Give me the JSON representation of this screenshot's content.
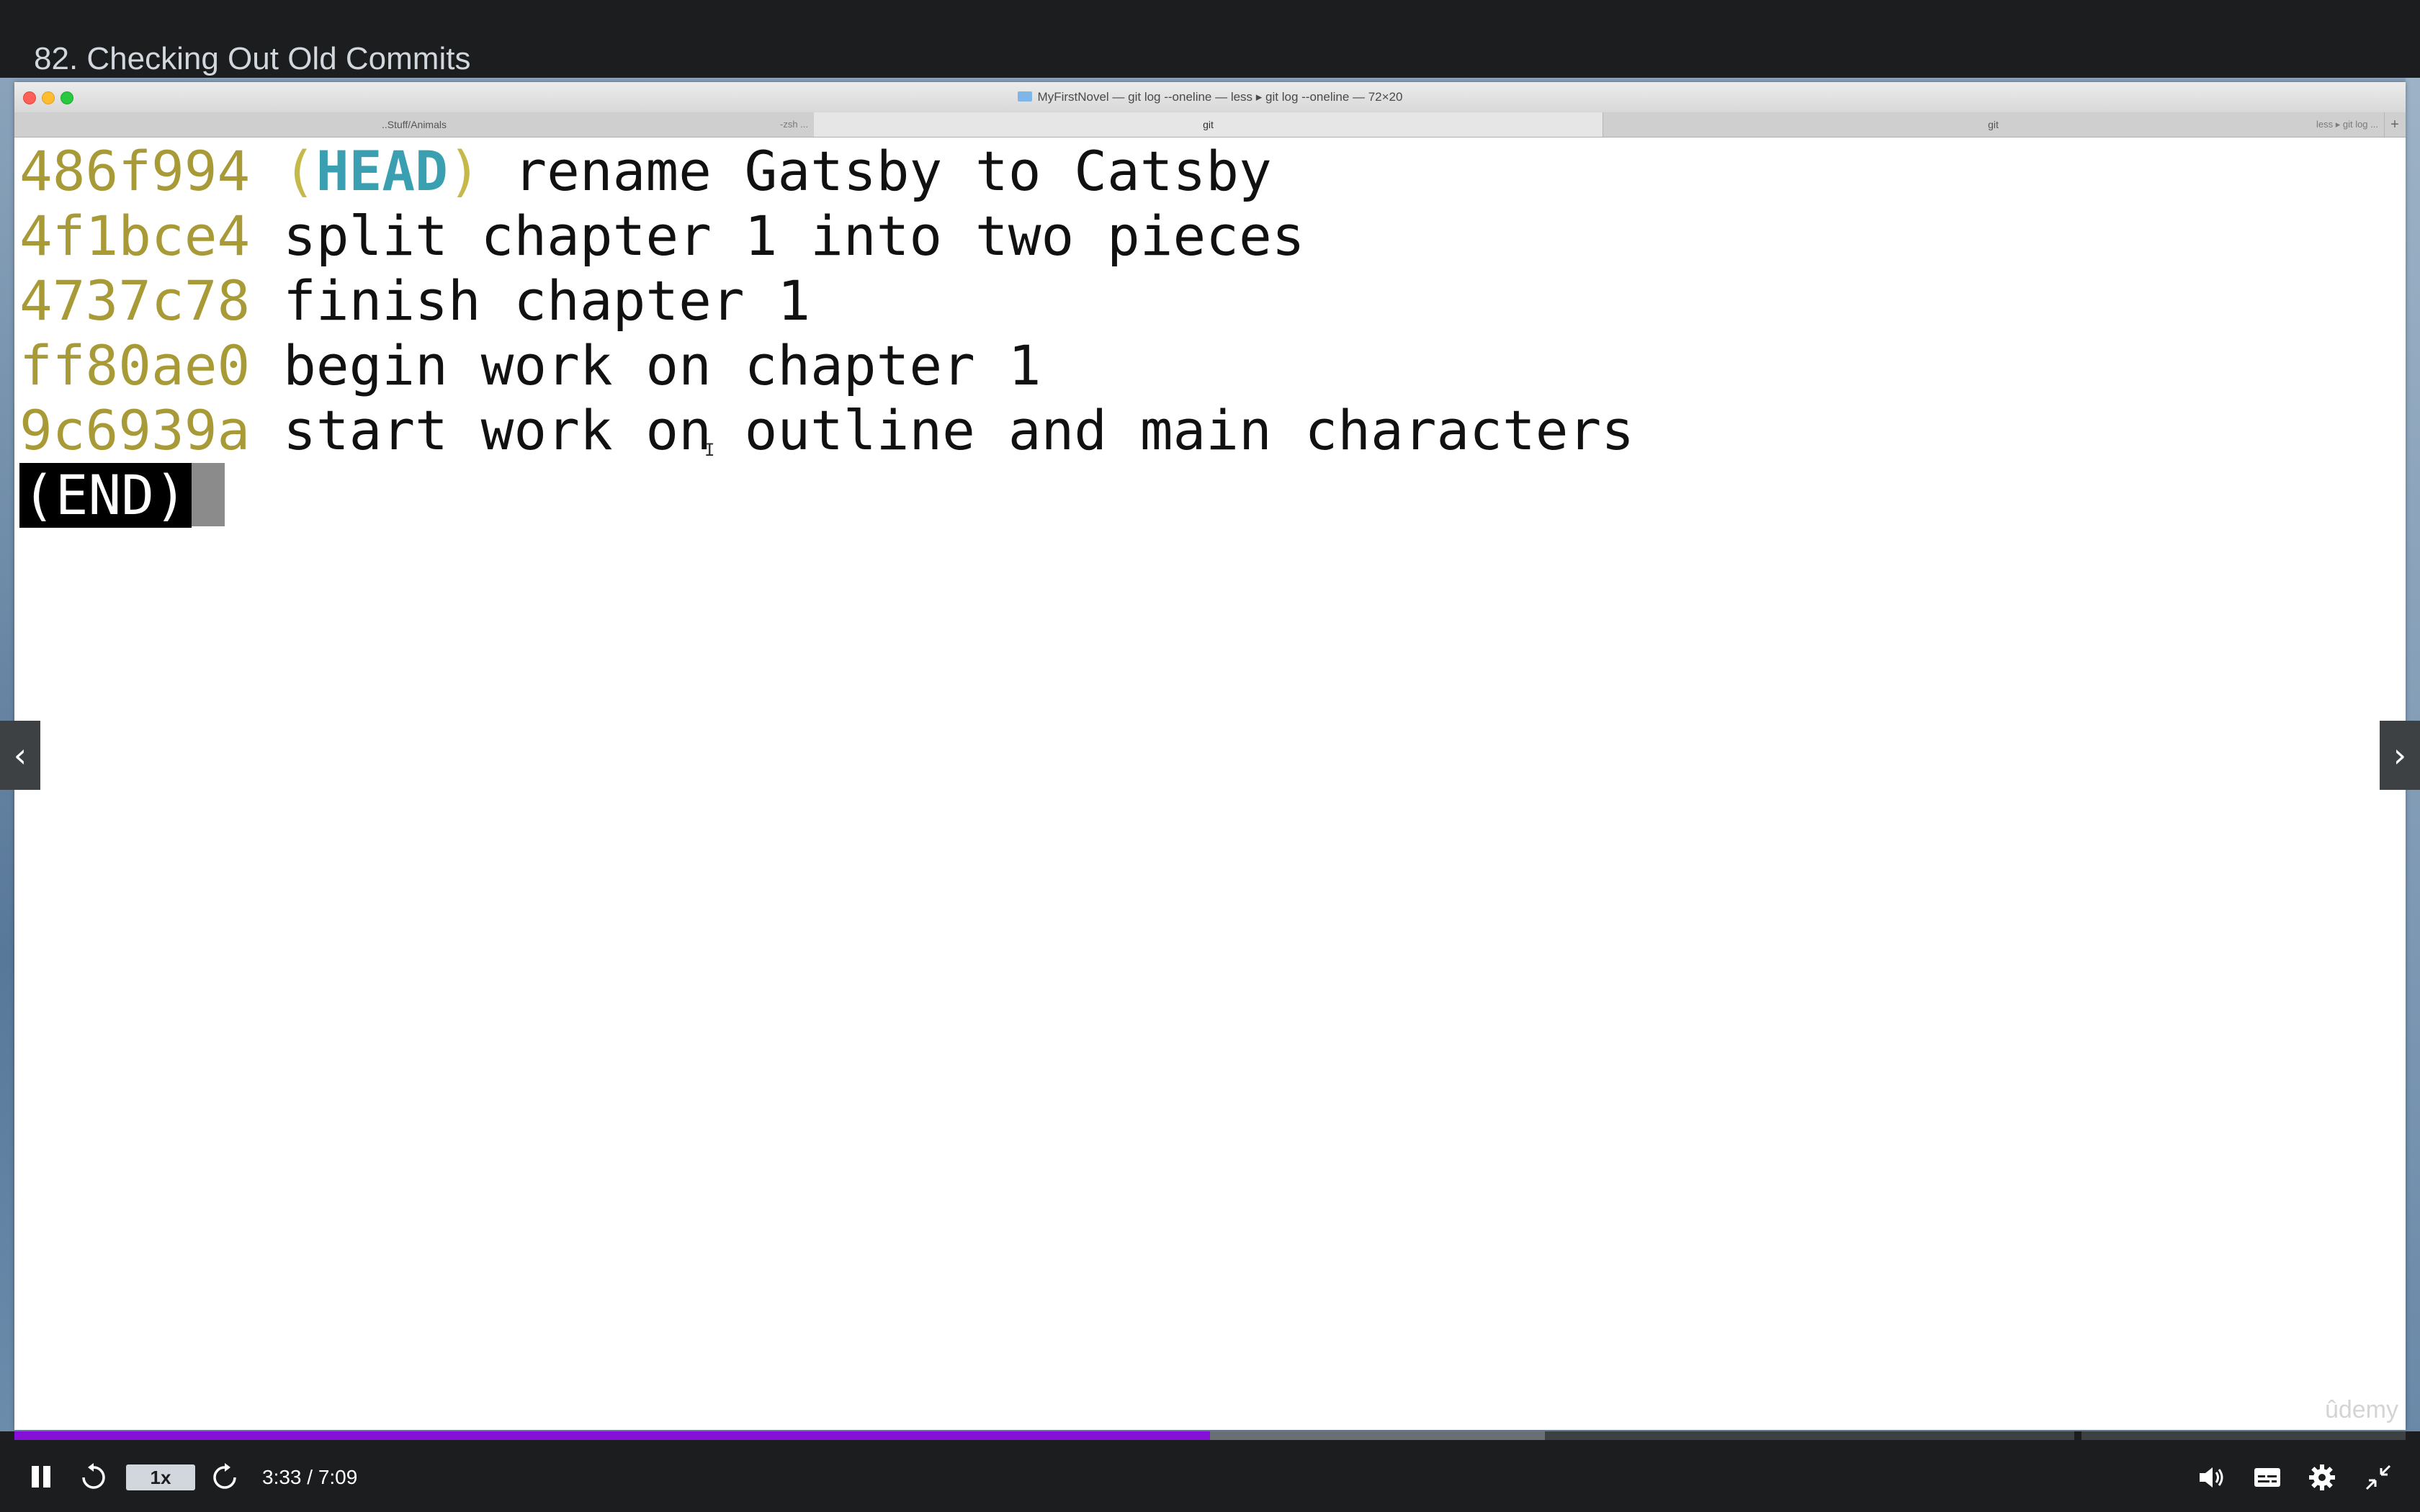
{
  "lecture": {
    "title": "82. Checking Out Old Commits"
  },
  "terminal": {
    "window_title": "MyFirstNovel — git log --oneline — less ▸ git log --oneline — 72×20",
    "tabs": [
      {
        "label": "..Stuff/Animals",
        "sub": "-zsh ..."
      },
      {
        "label": "git"
      },
      {
        "label": "git",
        "sub": "less ▸ git log ..."
      }
    ],
    "new_tab_label": "+",
    "commits": [
      {
        "hash": "486f994",
        "head_open": "(",
        "head": "HEAD",
        "head_close": ")",
        "message": "rename Gatsby to Catsby"
      },
      {
        "hash": "4f1bce4",
        "message": "split chapter 1 into two pieces"
      },
      {
        "hash": "4737c78",
        "message": "finish chapter 1"
      },
      {
        "hash": "ff80ae0",
        "message": "begin work on chapter 1"
      },
      {
        "hash": "9c6939a",
        "message": "start work on outline and main characters"
      }
    ],
    "end_marker": "(END)",
    "watermark": "ûdemy"
  },
  "player": {
    "prev_label": "‹",
    "next_label": "›",
    "speed": "1x",
    "time": "3:33 / 7:09",
    "progress_played": 0.5,
    "progress_buffered": 0.64,
    "accent_color": "#8710d8",
    "icons": [
      "pause-icon",
      "rewind-icon",
      "forward-icon",
      "volume-icon",
      "captions-icon",
      "settings-icon",
      "fullscreen-icon"
    ]
  }
}
